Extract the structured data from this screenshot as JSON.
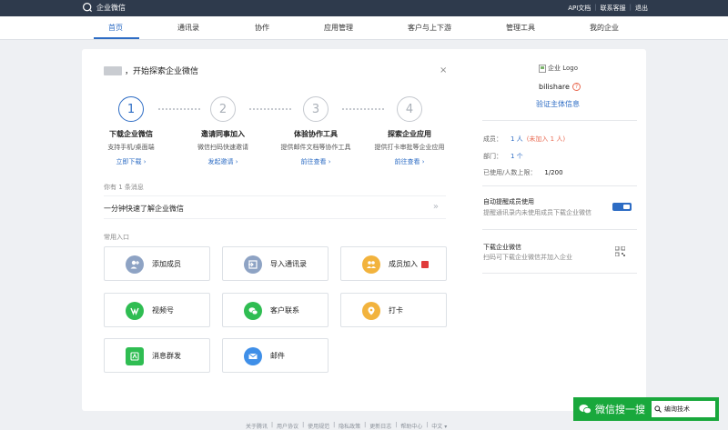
{
  "topbar": {
    "brand": "企业微信",
    "links": [
      "API文档",
      "联系客服",
      "退出"
    ]
  },
  "nav": {
    "items": [
      "首页",
      "通讯录",
      "协作",
      "应用管理",
      "客户与上下游",
      "管理工具",
      "我的企业"
    ],
    "active": "首页"
  },
  "intro": {
    "title": "开始探索企业微信",
    "close": "×",
    "steps": [
      {
        "num": "1",
        "title": "下载企业微信",
        "desc": "支持手机/桌面端",
        "link": "立即下载 ›"
      },
      {
        "num": "2",
        "title": "邀请同事加入",
        "desc": "微信扫码快速邀请",
        "link": "发起邀请 ›"
      },
      {
        "num": "3",
        "title": "体验协作工具",
        "desc": "提供邮件文档等协作工具",
        "link": "前往查看 ›"
      },
      {
        "num": "4",
        "title": "探索企业应用",
        "desc": "提供打卡审批等企业应用",
        "link": "前往查看 ›"
      }
    ]
  },
  "messages": {
    "label": "你有 1 条消息",
    "items": [
      {
        "text": "一分钟快速了解企业微信",
        "arrow": "»"
      }
    ]
  },
  "entries": {
    "label": "常用入口",
    "items": [
      {
        "label": "添加成员",
        "icon": "add-member-icon",
        "color": "#8ea3c4"
      },
      {
        "label": "导入通讯录",
        "icon": "import-contacts-icon",
        "color": "#8ea3c4"
      },
      {
        "label": "成员加入",
        "icon": "member-join-icon",
        "color": "#f2b33d"
      },
      {
        "label": "视频号",
        "icon": "channels-icon",
        "color": "#2fbd52"
      },
      {
        "label": "客户联系",
        "icon": "customer-contact-icon",
        "color": "#2fbd52"
      },
      {
        "label": "打卡",
        "icon": "check-in-icon",
        "color": "#f2b33d"
      },
      {
        "label": "消息群发",
        "icon": "mass-message-icon",
        "color": "#2fbd52"
      },
      {
        "label": "邮件",
        "icon": "mail-icon",
        "color": "#3f8fe8"
      }
    ]
  },
  "org": {
    "logo_alt": "企业 Logo",
    "name": "bilishare",
    "verify": "验证主体信息",
    "members_label": "成员：",
    "members_value": "1 人",
    "members_pending": "(未加入 1 人)",
    "depts_label": "部门：",
    "depts_value": "1 个",
    "usage_label": "已使用/人数上限：",
    "usage_value": "1/200"
  },
  "features": [
    {
      "title": "自动提醒成员使用",
      "desc": "提醒通讯录内未使用成员下载企业微信"
    },
    {
      "title": "下载企业微信",
      "desc": "扫码可下载企业微信并加入企业"
    }
  ],
  "footer": [
    "关于腾讯",
    "|",
    "用户协议",
    "|",
    "使用规范",
    "|",
    "隐私政策",
    "|",
    "更新日志",
    "|",
    "帮助中心",
    "|",
    "中文 ▾"
  ],
  "watermark": {
    "text": "微信搜一搜",
    "search": "编询技术"
  },
  "colors": {
    "accent": "#2d6cc4",
    "topbar": "#2e3a4c",
    "warning": "#e96b53"
  }
}
